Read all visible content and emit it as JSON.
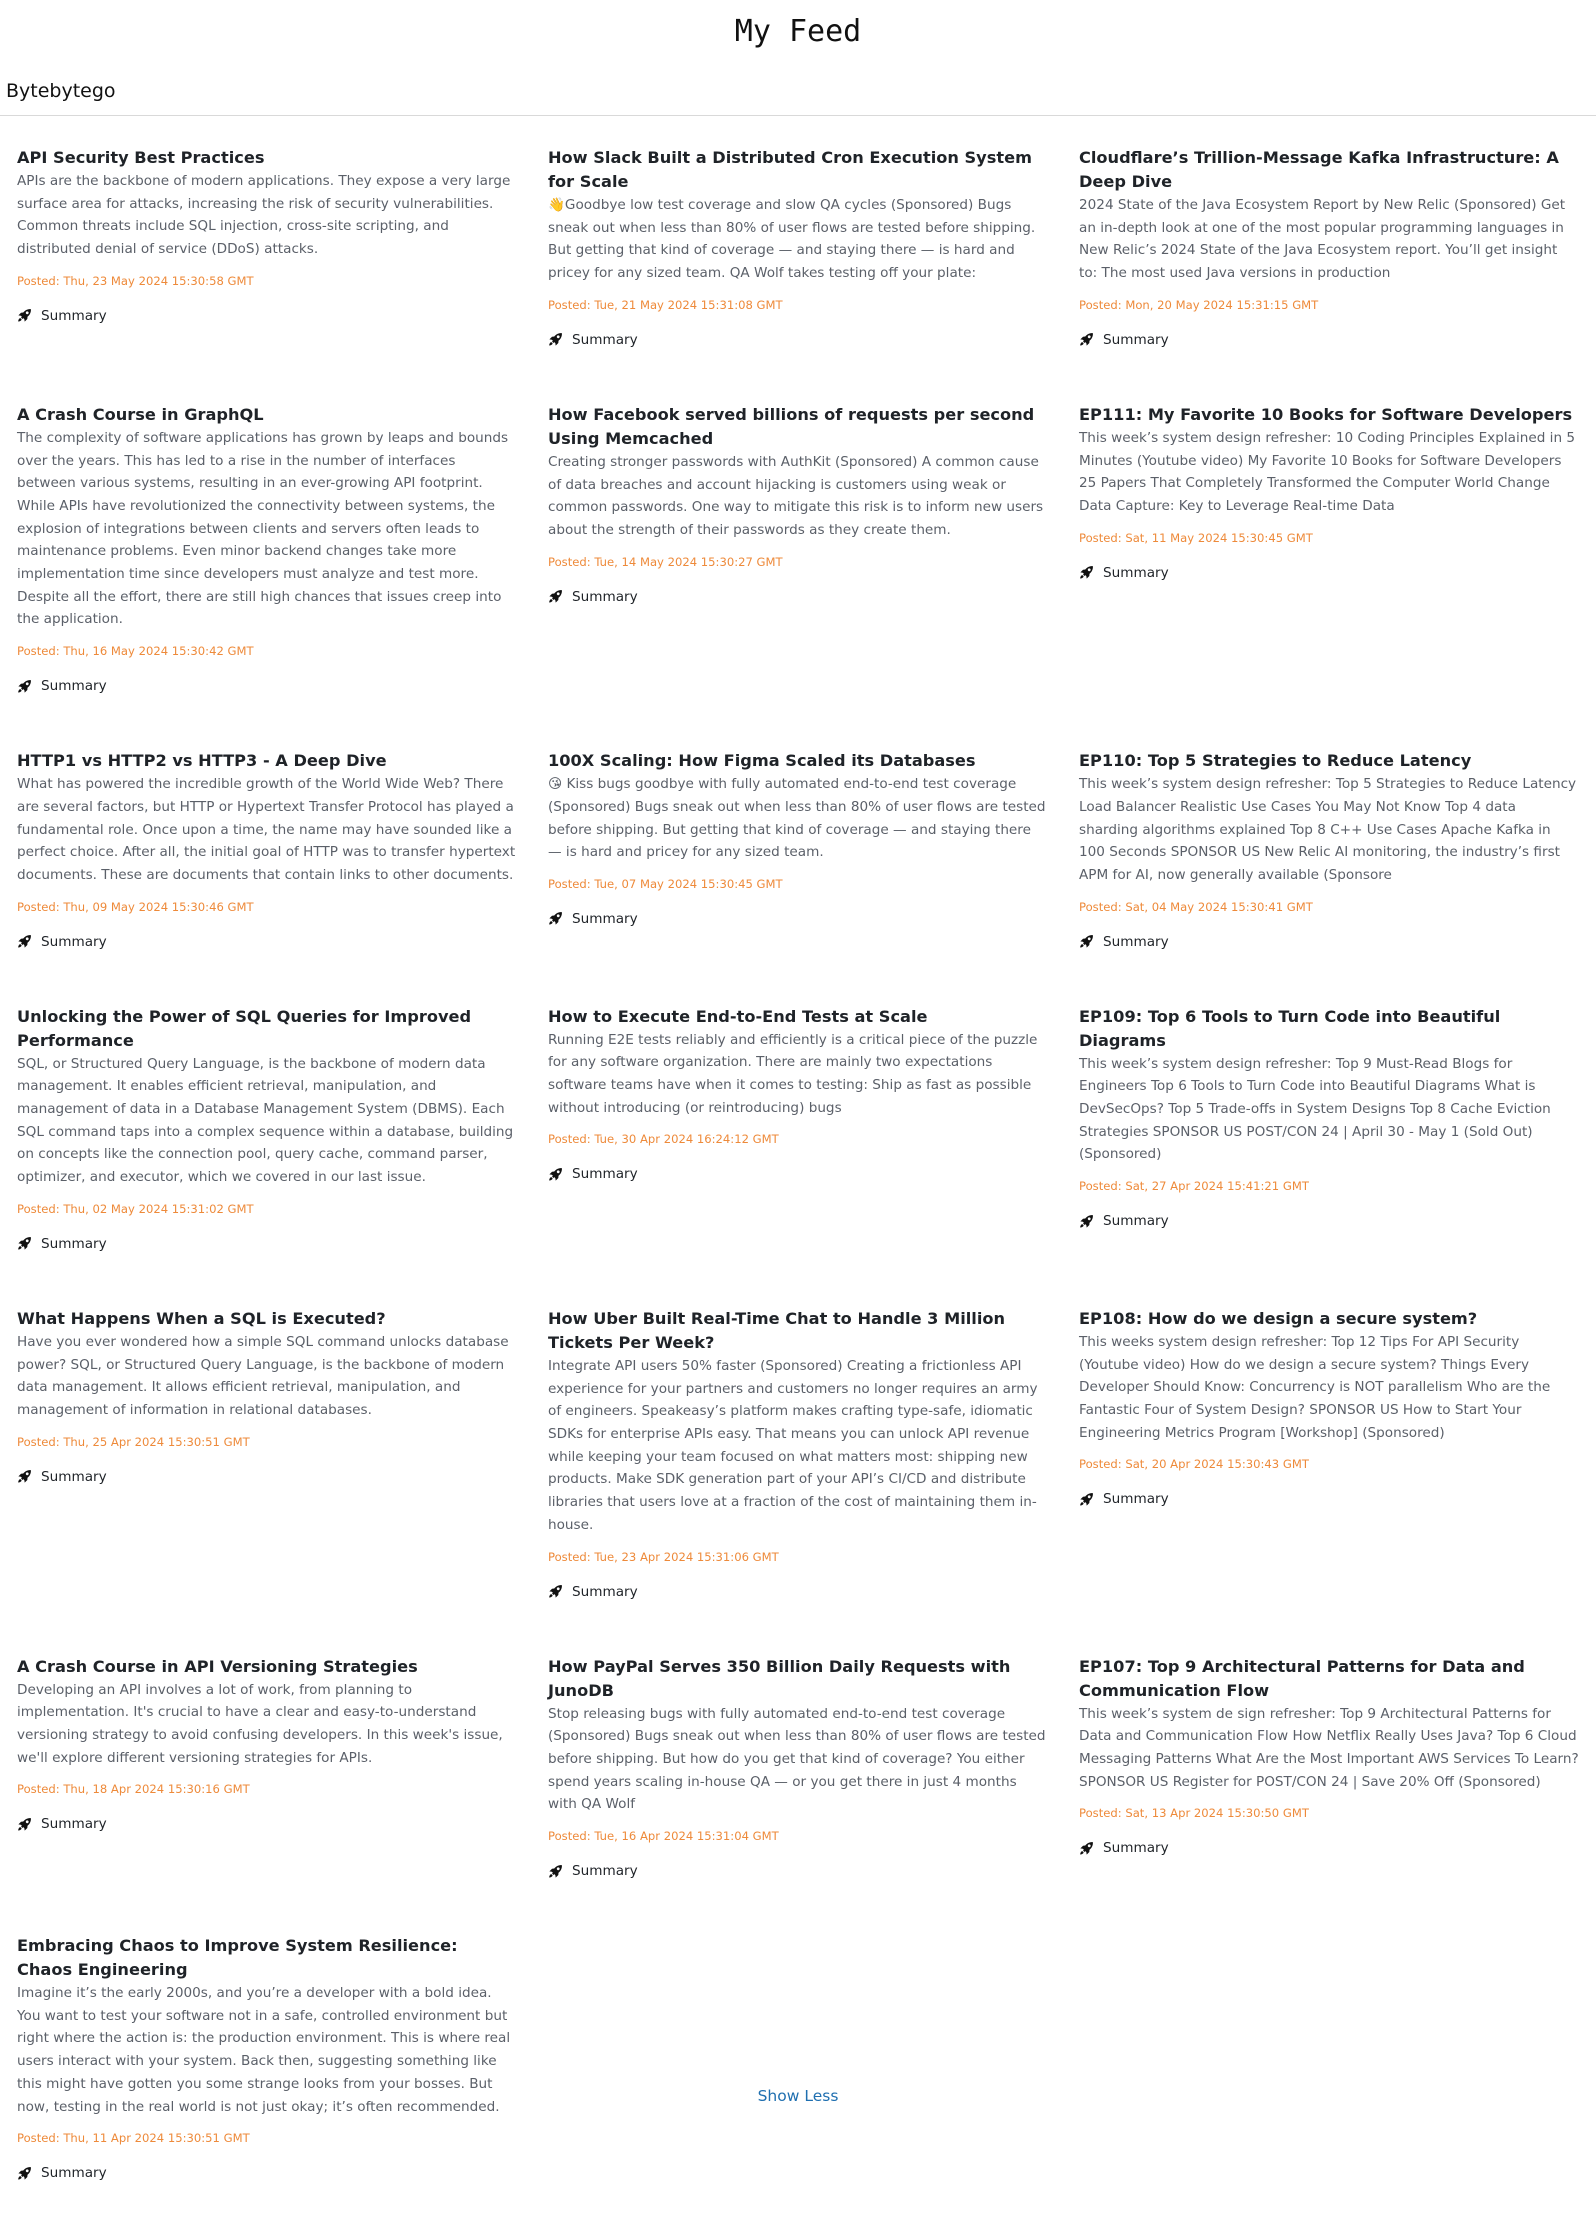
{
  "page": {
    "title": "My Feed"
  },
  "source": {
    "name": "Bytebytego"
  },
  "summary_label": "Summary",
  "show_less_label": "Show Less",
  "icons": {
    "summary": "rocket-icon"
  },
  "colors": {
    "date": "#ee8a3a",
    "link": "#1f6fb0"
  },
  "articles": [
    {
      "title": "API Security Best Practices",
      "description": "APIs are the backbone of modern applications. They expose a very large surface area for attacks, increasing the risk of security vulnerabilities. Common threats include SQL injection, cross-site scripting, and distributed denial of service (DDoS) attacks.",
      "posted": "Posted: Thu, 23 May 2024 15:30:58 GMT"
    },
    {
      "title": "How Slack Built a Distributed Cron Execution System for Scale",
      "description": "👋Goodbye low test coverage and slow QA cycles (Sponsored) Bugs sneak out when less than 80% of user flows are tested before shipping. But getting that kind of coverage — and staying there — is hard and pricey for any sized team. QA Wolf takes testing off your plate:",
      "posted": "Posted: Tue, 21 May 2024 15:31:08 GMT"
    },
    {
      "title": "Cloudflare’s Trillion-Message Kafka Infrastructure: A Deep Dive",
      "description": "2024 State of the Java Ecosystem Report by New Relic (Sponsored) Get an in-depth look at one of the most popular programming languages in New Relic’s 2024 State of the Java Ecosystem report. You’ll get insight to: The most used Java versions in production",
      "posted": "Posted: Mon, 20 May 2024 15:31:15 GMT"
    },
    {
      "title": "A Crash Course in GraphQL",
      "description": "The complexity of software applications has grown by leaps and bounds over the years. This has led to a rise in the number of interfaces between various systems, resulting in an ever-growing API footprint. While APIs have revolutionized the connectivity between systems, the explosion of integrations between clients and servers often leads to maintenance problems. Even minor backend changes take more implementation time since developers must analyze and test more. Despite all the effort, there are still high chances that issues creep into the application.",
      "posted": "Posted: Thu, 16 May 2024 15:30:42 GMT"
    },
    {
      "title": "How Facebook served billions of requests per second Using Memcached",
      "description": "Creating stronger passwords with AuthKit (Sponsored) A common cause of data breaches and account hijacking is customers using weak or common passwords. One way to mitigate this risk is to inform new users about the strength of their passwords as they create them.",
      "posted": "Posted: Tue, 14 May 2024 15:30:27 GMT"
    },
    {
      "title": "EP111: My Favorite 10 Books for Software Developers",
      "description": "This week’s system design refresher: 10 Coding Principles Explained in 5 Minutes (Youtube video) My Favorite 10 Books for Software Developers 25 Papers That Completely Transformed the Computer World Change Data Capture: Key to Leverage Real-time Data",
      "posted": "Posted: Sat, 11 May 2024 15:30:45 GMT"
    },
    {
      "title": "HTTP1 vs HTTP2 vs HTTP3 - A Deep Dive",
      "description": "What has powered the incredible growth of the World Wide Web? There are several factors, but HTTP or Hypertext Transfer Protocol has played a fundamental role. Once upon a time, the name may have sounded like a perfect choice. After all, the initial goal of HTTP was to transfer hypertext documents. These are documents that contain links to other documents.",
      "posted": "Posted: Thu, 09 May 2024 15:30:46 GMT"
    },
    {
      "title": "100X Scaling: How Figma Scaled its Databases",
      "description": "😘 Kiss bugs goodbye with fully automated end-to-end test coverage (Sponsored) Bugs sneak out when less than 80% of user flows are tested before shipping. But getting that kind of coverage — and staying there — is hard and pricey for any sized team.",
      "posted": "Posted: Tue, 07 May 2024 15:30:45 GMT"
    },
    {
      "title": "EP110: Top 5 Strategies to Reduce Latency",
      "description": "This week’s system design refresher: Top 5 Strategies to Reduce Latency Load Balancer Realistic Use Cases You May Not Know Top 4 data sharding algorithms explained Top 8 C++ Use Cases Apache Kafka in 100 Seconds SPONSOR US New Relic AI monitoring, the industry’s first APM for AI, now generally available (Sponsore",
      "posted": "Posted: Sat, 04 May 2024 15:30:41 GMT"
    },
    {
      "title": "Unlocking the Power of SQL Queries for Improved Performance",
      "description": "SQL, or Structured Query Language, is the backbone of modern data management. It enables efficient retrieval, manipulation, and management of data in a Database Management System (DBMS). Each SQL command taps into a complex sequence within a database, building on concepts like the connection pool, query cache, command parser, optimizer, and executor, which we covered in our last issue.",
      "posted": "Posted: Thu, 02 May 2024 15:31:02 GMT"
    },
    {
      "title": "How to Execute End-to-End Tests at Scale",
      "description": "Running E2E tests reliably and efficiently is a critical piece of the puzzle for any software organization. There are mainly two expectations software teams have when it comes to testing: Ship as fast as possible without introducing (or reintroducing) bugs",
      "posted": "Posted: Tue, 30 Apr 2024 16:24:12 GMT"
    },
    {
      "title": "EP109: Top 6 Tools to Turn Code into Beautiful Diagrams",
      "description": "This week’s system design refresher: Top 9 Must-Read Blogs for Engineers Top 6 Tools to Turn Code into Beautiful Diagrams What is DevSecOps? Top 5 Trade-offs in System Designs Top 8 Cache Eviction Strategies SPONSOR US POST/CON 24 | April 30 - May 1 (Sold Out)(Sponsored)",
      "posted": "Posted: Sat, 27 Apr 2024 15:41:21 GMT"
    },
    {
      "title": "What Happens When a SQL is Executed?",
      "description": "Have you ever wondered how a simple SQL command unlocks database power? SQL, or Structured Query Language, is the backbone of modern data management. It allows efficient retrieval, manipulation, and management of information in relational databases.",
      "posted": "Posted: Thu, 25 Apr 2024 15:30:51 GMT"
    },
    {
      "title": "How Uber Built Real-Time Chat to Handle 3 Million Tickets Per Week?",
      "description": "Integrate API users 50% faster (Sponsored) Creating a frictionless API experience for your partners and customers no longer requires an army of engineers. Speakeasy’s platform makes crafting type-safe, idiomatic SDKs for enterprise APIs easy. That means you can unlock API revenue while keeping your team focused on what matters most: shipping new products. Make SDK generation part of your API’s CI/CD and distribute libraries that users love at a fraction of the cost of maintaining them in-house.",
      "posted": "Posted: Tue, 23 Apr 2024 15:31:06 GMT"
    },
    {
      "title": "EP108: How do we design a secure system?",
      "description": "This weeks system design refresher: Top 12 Tips For API Security (Youtube video) How do we design a secure system? Things Every Developer Should Know: Concurrency is NOT parallelism Who are the Fantastic Four of System Design? SPONSOR US How to Start Your Engineering Metrics Program [Workshop] (Sponsored)",
      "posted": "Posted: Sat, 20 Apr 2024 15:30:43 GMT"
    },
    {
      "title": "A Crash Course in API Versioning Strategies",
      "description": "Developing an API involves a lot of work, from planning to implementation. It's crucial to have a clear and easy-to-understand versioning strategy to avoid confusing developers. In this week's issue, we'll explore different versioning strategies for APIs.",
      "posted": "Posted: Thu, 18 Apr 2024 15:30:16 GMT"
    },
    {
      "title": "How PayPal Serves 350 Billion Daily Requests with JunoDB",
      "description": "Stop releasing bugs with fully automated end-to-end test coverage (Sponsored) Bugs sneak out when less than 80% of user flows are tested before shipping. But how do you get that kind of coverage? You either spend years scaling in-house QA — or you get there in just 4 months with QA Wolf",
      "posted": "Posted: Tue, 16 Apr 2024 15:31:04 GMT"
    },
    {
      "title": "EP107: Top 9 Architectural Patterns for Data and Communication Flow",
      "description": "This week’s system de sign refresher: Top 9 Architectural Patterns for Data and Communication Flow How Netflix Really Uses Java? Top 6 Cloud Messaging Patterns What Are the Most Important AWS Services To Learn? SPONSOR US Register for POST/CON 24 | Save 20% Off (Sponsored)",
      "posted": "Posted: Sat, 13 Apr 2024 15:30:50 GMT"
    },
    {
      "title": "Embracing Chaos to Improve System Resilience: Chaos Engineering",
      "description": "Imagine it’s the early 2000s, and you’re a developer with a bold idea. You want to test your software not in a safe, controlled environment but right where the action is: the production environment. This is where real users interact with your system. Back then, suggesting something like this might have gotten you some strange looks from your bosses. But now, testing in the real world is not just okay; it’s often recommended.",
      "posted": "Posted: Thu, 11 Apr 2024 15:30:51 GMT"
    }
  ]
}
